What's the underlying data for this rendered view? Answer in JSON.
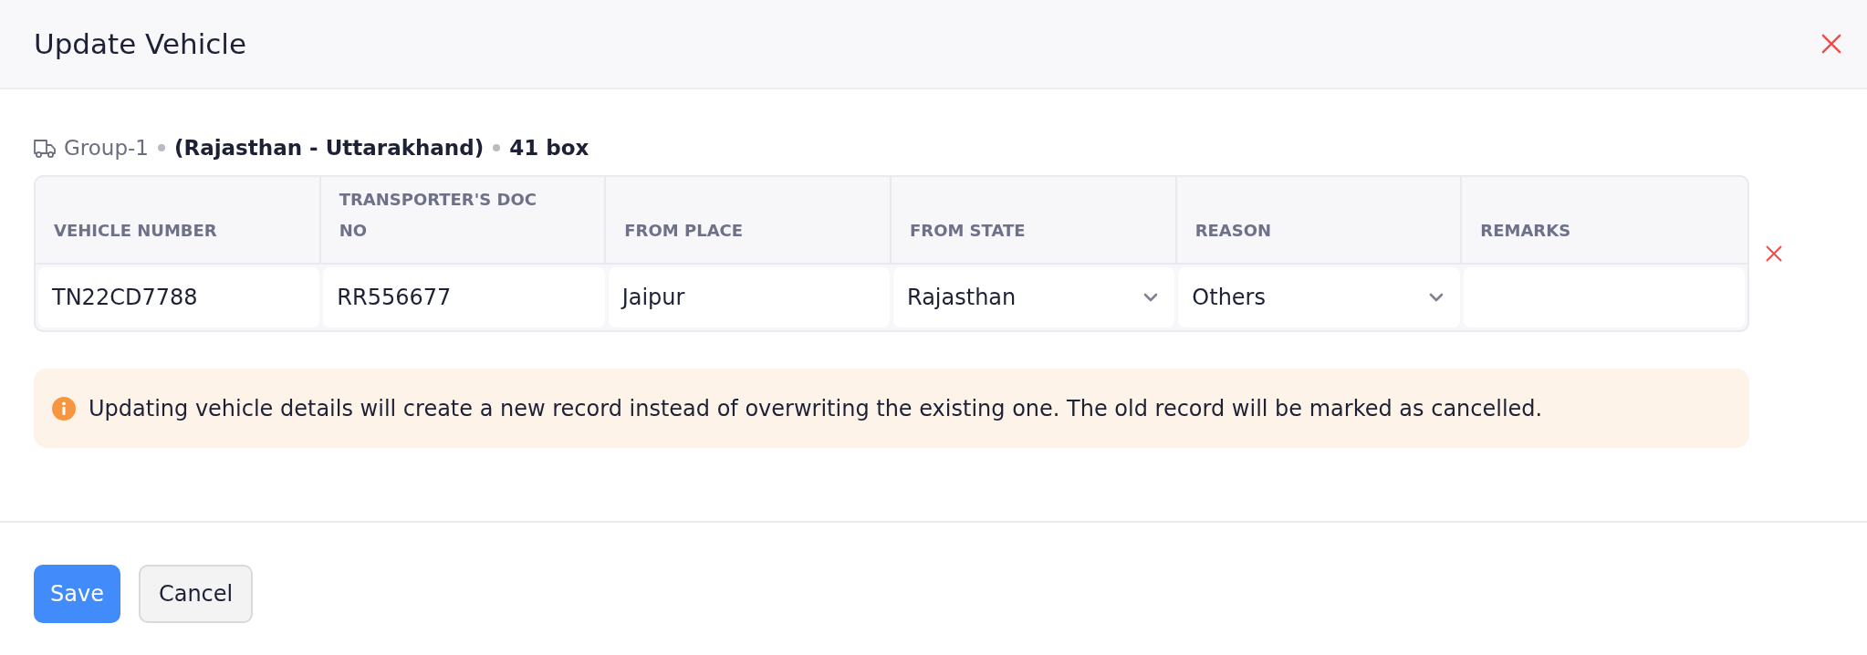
{
  "dialog": {
    "title": "Update Vehicle"
  },
  "group": {
    "name": "Group-1",
    "route": "(Rajasthan - Uttarakhand)",
    "quantity": "41 box"
  },
  "table": {
    "columns": [
      "VEHICLE NUMBER",
      "TRANSPORTER'S DOC NO",
      "FROM PLACE",
      "FROM STATE",
      "REASON",
      "REMARKS"
    ],
    "rows": [
      {
        "cells": [
          {
            "kind": "text",
            "value": "TN22CD7788"
          },
          {
            "kind": "text",
            "value": "RR556677"
          },
          {
            "kind": "text",
            "value": "Jaipur"
          },
          {
            "kind": "select",
            "value": "Rajasthan"
          },
          {
            "kind": "select",
            "value": "Others"
          },
          {
            "kind": "text"
          }
        ]
      }
    ]
  },
  "notice": {
    "text": "Updating vehicle details will create a new record instead of overwriting the existing one. The old record will be marked as cancelled."
  },
  "buttons": [
    {
      "label": "Save",
      "kind": "primary"
    },
    {
      "label": "Cancel",
      "kind": "secondary"
    }
  ]
}
